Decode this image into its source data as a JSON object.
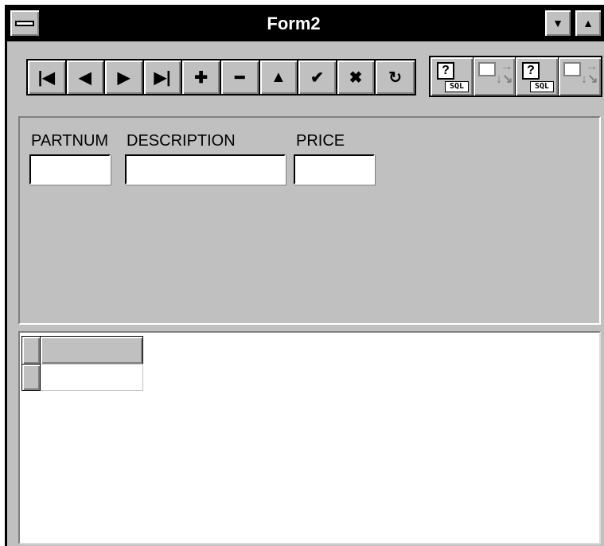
{
  "window": {
    "title": "Form2",
    "minimize_glyph": "▼",
    "maximize_glyph": "▲"
  },
  "toolbar": {
    "nav_buttons": [
      {
        "name": "first-record-button",
        "icon": "first-record-icon",
        "glyph": "|◀"
      },
      {
        "name": "previous-record-button",
        "icon": "previous-record-icon",
        "glyph": "◀"
      },
      {
        "name": "next-record-button",
        "icon": "next-record-icon",
        "glyph": "▶"
      },
      {
        "name": "last-record-button",
        "icon": "last-record-icon",
        "glyph": "▶|"
      },
      {
        "name": "insert-record-button",
        "icon": "plus-icon",
        "glyph": "✚"
      },
      {
        "name": "delete-record-button",
        "icon": "minus-icon",
        "glyph": "━"
      },
      {
        "name": "edit-record-button",
        "icon": "up-arrow-icon",
        "glyph": "▲"
      },
      {
        "name": "post-record-button",
        "icon": "checkmark-icon",
        "glyph": "✔"
      },
      {
        "name": "cancel-edit-button",
        "icon": "x-icon",
        "glyph": "✖"
      },
      {
        "name": "refresh-button",
        "icon": "refresh-icon",
        "glyph": "↻"
      }
    ],
    "sql_buttons": [
      {
        "name": "sql-query-button-1",
        "icon": "sql-query-icon",
        "doc_glyph": "?",
        "label": "SQL",
        "enabled": true
      },
      {
        "name": "sql-flow-button-1",
        "icon": "data-flow-icon",
        "arrows": "→ ↓↘",
        "enabled": false
      },
      {
        "name": "sql-query-button-2",
        "icon": "sql-query-icon",
        "doc_glyph": "?",
        "label": "SQL",
        "enabled": true
      },
      {
        "name": "sql-flow-button-2",
        "icon": "data-flow-icon",
        "arrows": "→ ↓↘",
        "enabled": false
      }
    ]
  },
  "form": {
    "partnum_label": "PARTNUM",
    "partnum_value": "",
    "description_label": "DESCRIPTION",
    "description_value": "",
    "price_label": "PRICE",
    "price_value": ""
  },
  "grid": {
    "header_cells": [
      ""
    ],
    "rows": [
      [
        ""
      ]
    ]
  },
  "colors": {
    "face": "#c0c0c0",
    "titlebar": "#000000",
    "title_text": "#ffffff",
    "shadow": "#808080",
    "highlight": "#ffffff"
  }
}
